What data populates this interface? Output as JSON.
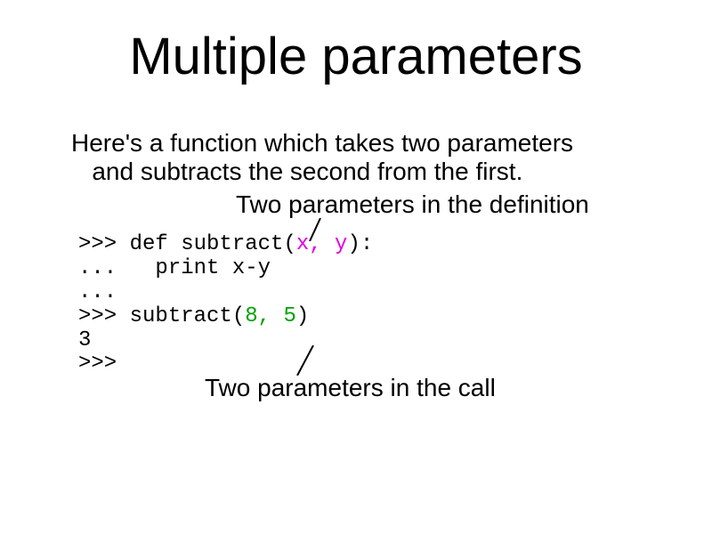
{
  "title": "Multiple parameters",
  "intro_line1": "Here's a function which takes two parameters",
  "intro_line2": "and subtracts the second from the first.",
  "def_annotation": "Two parameters in the definition",
  "call_annotation": "Two parameters in the call",
  "code": {
    "l1_prompt": ">>> ",
    "l1_def": "def subtract(",
    "l1_params": "x, y",
    "l1_end": "):",
    "l2_cont": "...   ",
    "l2_body": "print x-y",
    "l3_cont": "... ",
    "l4_prompt": ">>> ",
    "l4_call": "subtract(",
    "l4_args": "8, 5",
    "l4_end": ")",
    "l5_out": "3",
    "l6_prompt": ">>> "
  }
}
